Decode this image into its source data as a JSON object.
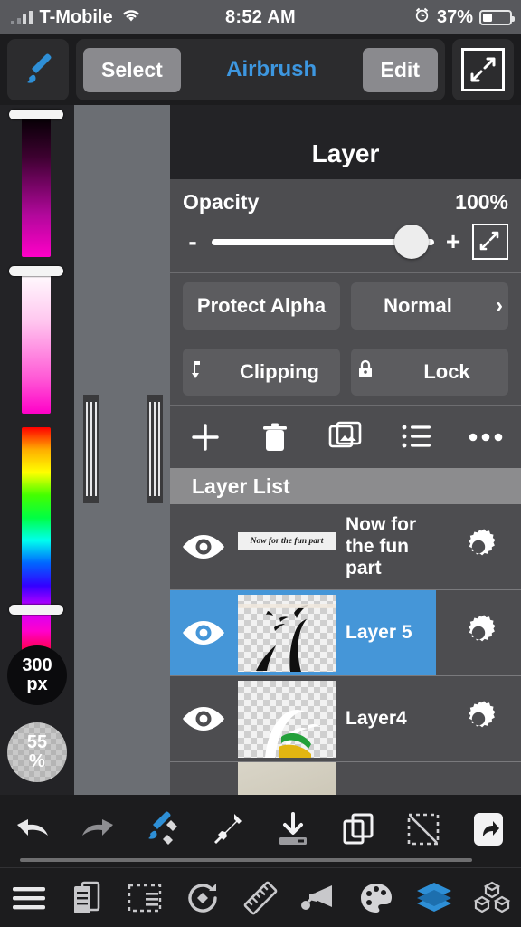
{
  "statusbar": {
    "carrier": "T-Mobile",
    "time": "8:52 AM",
    "battery_percent": "37%",
    "signal_icon": "signal-bars-icon",
    "wifi_icon": "wifi-icon",
    "alarm_icon": "alarm-clock-icon",
    "battery_icon": "battery-icon"
  },
  "topbar": {
    "brush_tool_icon": "paintbrush-icon",
    "select_label": "Select",
    "title": "Airbrush",
    "edit_label": "Edit",
    "expand_icon": "expand-diagonal-icon",
    "title_color": "#3d97e0"
  },
  "colortools": {
    "brightness_slider_name": "brightness-slider",
    "saturation_slider_name": "saturation-slider",
    "hue_slider_name": "hue-slider",
    "brush_size_value": "300",
    "brush_size_unit": "px",
    "brush_opacity_value": "55",
    "brush_opacity_unit": "%"
  },
  "panel": {
    "title": "Layer",
    "opacity_label": "Opacity",
    "opacity_value": "100%",
    "opacity_percent": 100,
    "minus_label": "-",
    "plus_label": "+",
    "expand_icon": "expand-diagonal-icon",
    "protect_alpha_label": "Protect Alpha",
    "blend_mode_label": "Normal",
    "blend_chevron": "›",
    "clipping_label": "Clipping",
    "clipping_icon": "clipping-arrow-icon",
    "lock_label": "Lock",
    "lock_icon": "padlock-icon",
    "actions": [
      {
        "name": "add-layer-icon",
        "glyph": "+"
      },
      {
        "name": "delete-layer-icon",
        "glyph": "trash"
      },
      {
        "name": "import-image-icon",
        "glyph": "images"
      },
      {
        "name": "layer-options-list-icon",
        "glyph": "list"
      },
      {
        "name": "more-options-icon",
        "glyph": "dots"
      }
    ],
    "list_header": "Layer List",
    "layers": [
      {
        "name": "Now for the fun part",
        "visible": true,
        "selected": false,
        "thumb_type": "text",
        "thumb_text": "Now for the fun part",
        "gear_icon": "gear-icon",
        "eye_icon": "eye-visible-icon"
      },
      {
        "name": "Layer 5",
        "visible": true,
        "selected": true,
        "thumb_type": "silhouette",
        "thumb_text": "",
        "gear_icon": "gear-icon",
        "eye_icon": "eye-visible-icon"
      },
      {
        "name": "Layer4",
        "visible": true,
        "selected": false,
        "thumb_type": "paint",
        "thumb_text": "",
        "gear_icon": "gear-icon",
        "eye_icon": "eye-visible-icon"
      },
      {
        "name": "",
        "visible": true,
        "selected": false,
        "thumb_type": "photo",
        "thumb_text": "",
        "gear_icon": "gear-icon",
        "eye_icon": "eye-visible-icon"
      }
    ],
    "selected_color": "#4596d8"
  },
  "bottombar_actions": [
    {
      "name": "undo-icon"
    },
    {
      "name": "redo-icon"
    },
    {
      "name": "brush-eraser-icon"
    },
    {
      "name": "eyedropper-icon"
    },
    {
      "name": "download-icon"
    },
    {
      "name": "duplicate-icon"
    },
    {
      "name": "deselect-icon"
    },
    {
      "name": "share-icon"
    }
  ],
  "bottombar_nav": [
    {
      "name": "menu-icon",
      "active": false
    },
    {
      "name": "pages-icon",
      "active": false
    },
    {
      "name": "selection-icon",
      "active": false
    },
    {
      "name": "transform-icon",
      "active": false
    },
    {
      "name": "ruler-icon",
      "active": false
    },
    {
      "name": "spray-icon",
      "active": false
    },
    {
      "name": "palette-icon",
      "active": false
    },
    {
      "name": "layers-icon",
      "active": true
    },
    {
      "name": "materials-icon",
      "active": false
    }
  ]
}
